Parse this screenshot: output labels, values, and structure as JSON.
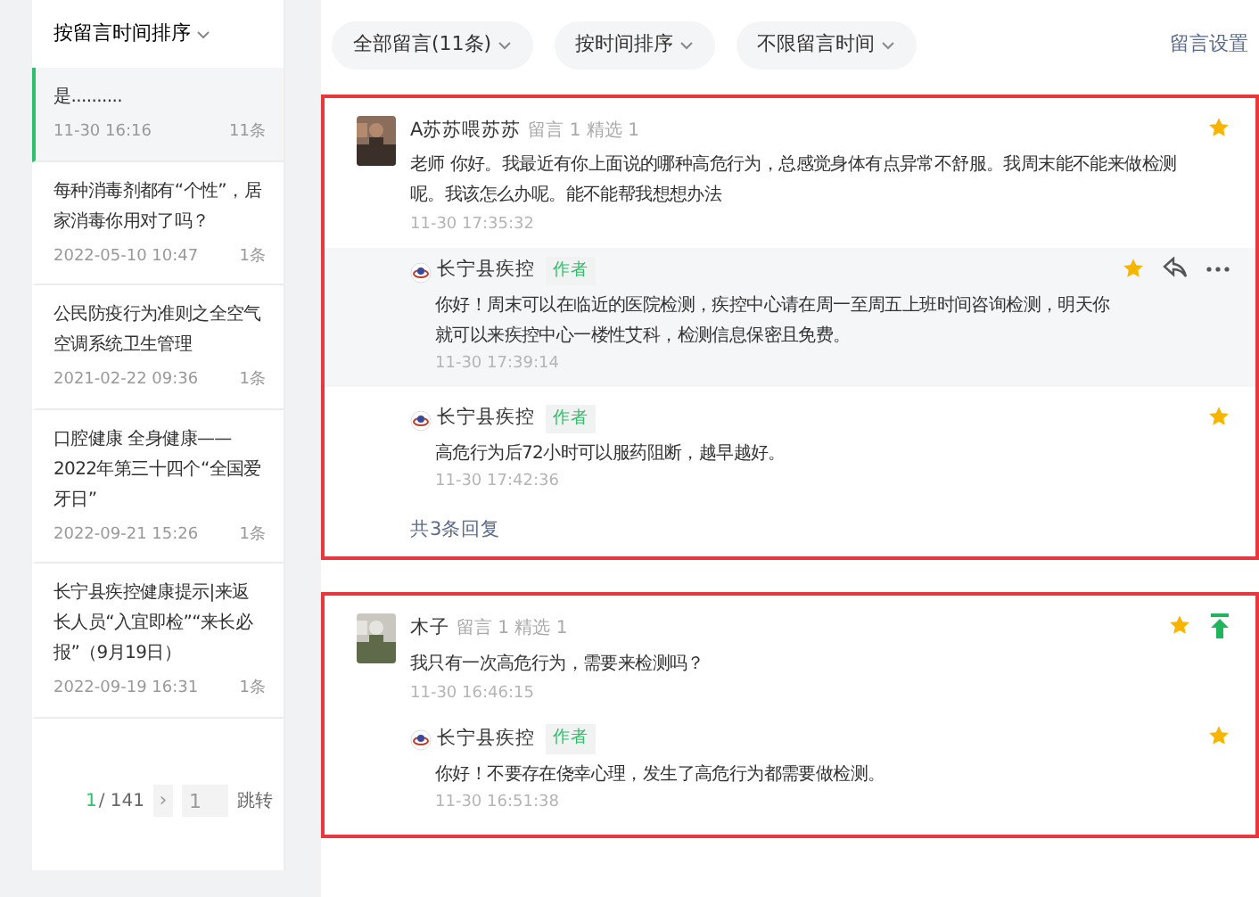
{
  "sidebar": {
    "sort_label": "按留言时间排序",
    "items": [
      {
        "title": "是..........",
        "date": "11-30 16:16",
        "count": "11条",
        "selected": true
      },
      {
        "title": "每种消毒剂都有“个性”，居家消毒你用对了吗？",
        "date": "2022-05-10 10:47",
        "count": "1条",
        "selected": false
      },
      {
        "title": "公民防疫行为准则之全空气空调系统卫生管理",
        "date": "2021-02-22 09:36",
        "count": "1条",
        "selected": false
      },
      {
        "title": "口腔健康 全身健康——2022年第三十四个“全国爱牙日”",
        "date": "2022-09-21 15:26",
        "count": "1条",
        "selected": false
      },
      {
        "title": "长宁县疾控健康提示|来返长人员“入宜即检”“来长必报”（9月19日）",
        "date": "2022-09-19 16:31",
        "count": "1条",
        "selected": false
      }
    ],
    "pagination": {
      "current": "1",
      "total": "/ 141",
      "next": "›",
      "page_input": "1",
      "jump": "跳转"
    }
  },
  "filters": [
    {
      "label": "全部留言(11条)"
    },
    {
      "label": "按时间排序"
    },
    {
      "label": "不限留言时间"
    }
  ],
  "settings_link": "留言设置",
  "comments": [
    {
      "user": "A苏苏喂苏苏",
      "stats": "留言 1 精选 1",
      "text": "老师 你好。我最近有你上面说的哪种高危行为，总感觉身体有点异常不舒服。我周末能不能来做检测呢。我该怎么办呢。能不能帮我想想办法",
      "time": "11-30 17:35:32",
      "starred": true,
      "pinned": false,
      "highlighted": true,
      "replies": [
        {
          "user": "长宁县疾控",
          "tag": "作者",
          "text": "你好！周末可以在临近的医院检测，疾控中心请在周一至周五上班时间咨询检测，明天你就可以来疾控中心一楼性艾科，检测信息保密且免费。",
          "time": "11-30 17:39:14",
          "starred": true,
          "hovered": true
        },
        {
          "user": "长宁县疾控",
          "tag": "作者",
          "text": "高危行为后72小时可以服药阻断，越早越好。",
          "time": "11-30 17:42:36",
          "starred": true,
          "hovered": false
        }
      ],
      "reply_count": "共3条回复"
    },
    {
      "user": "木子",
      "stats": "留言 1 精选 1",
      "text": "我只有一次高危行为，需要来检测吗？",
      "time": "11-30 16:46:15",
      "starred": true,
      "pinned": true,
      "highlighted": true,
      "replies": [
        {
          "user": "长宁县疾控",
          "tag": "作者",
          "text": "你好！不要存在侥幸心理，发生了高危行为都需要做检测。",
          "time": "11-30 16:51:38",
          "starred": true,
          "hovered": false
        }
      ]
    }
  ]
}
